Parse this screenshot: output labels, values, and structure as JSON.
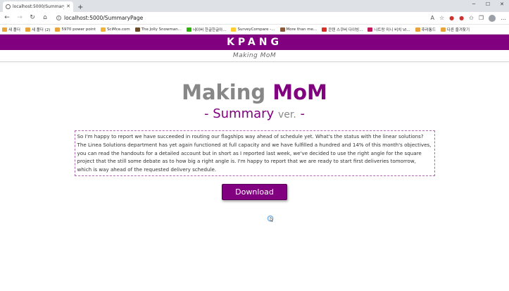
{
  "browser": {
    "tab_title": "localhost:5000/SummaryPage",
    "new_tab_symbol": "+",
    "url": "localhost:5000/SummaryPage",
    "bookmarks": [
      {
        "label": "새 폴더",
        "color": "#e8a33b"
      },
      {
        "label": "새 폴더 (2)",
        "color": "#e8a33b"
      },
      {
        "label": "5970 power point",
        "color": "#e8a33b"
      },
      {
        "label": "SciMce.com",
        "color": "#f2b233"
      },
      {
        "label": "The Jolly Snowman...",
        "color": "#6b4c2a"
      },
      {
        "label": "네이버 한글한글아...",
        "color": "#2db400"
      },
      {
        "label": "SurveyCompare -...",
        "color": "#ffcc33"
      },
      {
        "label": "More than me...",
        "color": "#8a5a3a"
      },
      {
        "label": "콘텐 스쿠버 다이빙...",
        "color": "#d93025"
      },
      {
        "label": "나트랑 미니 비치 VI...",
        "color": "#c2185b"
      },
      {
        "label": "후라통드",
        "color": "#e8a33b"
      },
      {
        "label": "다른 즐겨찾기",
        "color": "#e8a33b"
      }
    ]
  },
  "site": {
    "brand": "KPANG",
    "subtitle": "Making MoM",
    "title_part1": "Making",
    "title_part2": "MoM",
    "sub_dash_left": "-",
    "sub_word": "Summary",
    "sub_ver": "ver.",
    "sub_dash_right": "-",
    "summary_text": "So I'm happy to report we have succeeded in routing our flagships way ahead of schedule yet. What's the status with the linear solutions? The Linea Solutions department has yet again functioned at full capacity and we have fulfilled a hundred and 14% of this month's objectives, you can read the handouts for a detailed account but in short as I reported last week, we've decided to use the right angle for the square project that the still some debate as to how big a right angle is. I'm happy to report that we are ready to start first deliveries tomorrow, which is way ahead of the requested delivery schedule.",
    "download_label": "Download"
  },
  "colors": {
    "brand_purple": "#800080",
    "title_grey": "#878787"
  }
}
